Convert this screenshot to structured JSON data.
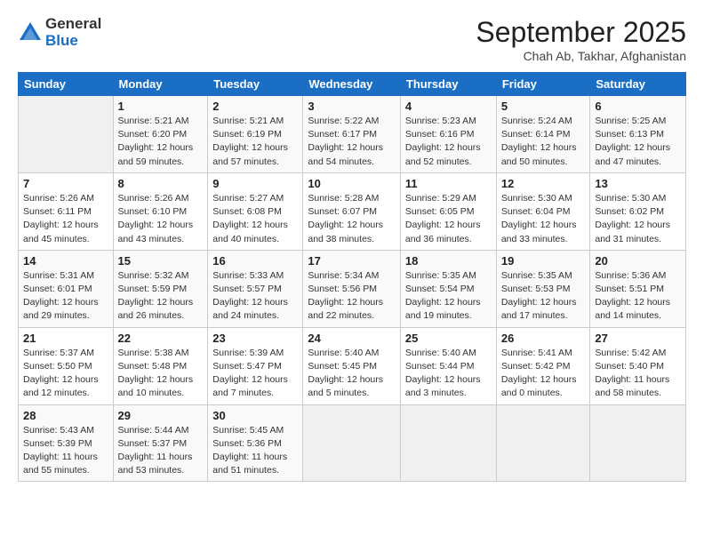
{
  "header": {
    "logo_general": "General",
    "logo_blue": "Blue",
    "month_title": "September 2025",
    "location": "Chah Ab, Takhar, Afghanistan"
  },
  "weekdays": [
    "Sunday",
    "Monday",
    "Tuesday",
    "Wednesday",
    "Thursday",
    "Friday",
    "Saturday"
  ],
  "weeks": [
    [
      {
        "day": "",
        "info": ""
      },
      {
        "day": "1",
        "info": "Sunrise: 5:21 AM\nSunset: 6:20 PM\nDaylight: 12 hours\nand 59 minutes."
      },
      {
        "day": "2",
        "info": "Sunrise: 5:21 AM\nSunset: 6:19 PM\nDaylight: 12 hours\nand 57 minutes."
      },
      {
        "day": "3",
        "info": "Sunrise: 5:22 AM\nSunset: 6:17 PM\nDaylight: 12 hours\nand 54 minutes."
      },
      {
        "day": "4",
        "info": "Sunrise: 5:23 AM\nSunset: 6:16 PM\nDaylight: 12 hours\nand 52 minutes."
      },
      {
        "day": "5",
        "info": "Sunrise: 5:24 AM\nSunset: 6:14 PM\nDaylight: 12 hours\nand 50 minutes."
      },
      {
        "day": "6",
        "info": "Sunrise: 5:25 AM\nSunset: 6:13 PM\nDaylight: 12 hours\nand 47 minutes."
      }
    ],
    [
      {
        "day": "7",
        "info": "Sunrise: 5:26 AM\nSunset: 6:11 PM\nDaylight: 12 hours\nand 45 minutes."
      },
      {
        "day": "8",
        "info": "Sunrise: 5:26 AM\nSunset: 6:10 PM\nDaylight: 12 hours\nand 43 minutes."
      },
      {
        "day": "9",
        "info": "Sunrise: 5:27 AM\nSunset: 6:08 PM\nDaylight: 12 hours\nand 40 minutes."
      },
      {
        "day": "10",
        "info": "Sunrise: 5:28 AM\nSunset: 6:07 PM\nDaylight: 12 hours\nand 38 minutes."
      },
      {
        "day": "11",
        "info": "Sunrise: 5:29 AM\nSunset: 6:05 PM\nDaylight: 12 hours\nand 36 minutes."
      },
      {
        "day": "12",
        "info": "Sunrise: 5:30 AM\nSunset: 6:04 PM\nDaylight: 12 hours\nand 33 minutes."
      },
      {
        "day": "13",
        "info": "Sunrise: 5:30 AM\nSunset: 6:02 PM\nDaylight: 12 hours\nand 31 minutes."
      }
    ],
    [
      {
        "day": "14",
        "info": "Sunrise: 5:31 AM\nSunset: 6:01 PM\nDaylight: 12 hours\nand 29 minutes."
      },
      {
        "day": "15",
        "info": "Sunrise: 5:32 AM\nSunset: 5:59 PM\nDaylight: 12 hours\nand 26 minutes."
      },
      {
        "day": "16",
        "info": "Sunrise: 5:33 AM\nSunset: 5:57 PM\nDaylight: 12 hours\nand 24 minutes."
      },
      {
        "day": "17",
        "info": "Sunrise: 5:34 AM\nSunset: 5:56 PM\nDaylight: 12 hours\nand 22 minutes."
      },
      {
        "day": "18",
        "info": "Sunrise: 5:35 AM\nSunset: 5:54 PM\nDaylight: 12 hours\nand 19 minutes."
      },
      {
        "day": "19",
        "info": "Sunrise: 5:35 AM\nSunset: 5:53 PM\nDaylight: 12 hours\nand 17 minutes."
      },
      {
        "day": "20",
        "info": "Sunrise: 5:36 AM\nSunset: 5:51 PM\nDaylight: 12 hours\nand 14 minutes."
      }
    ],
    [
      {
        "day": "21",
        "info": "Sunrise: 5:37 AM\nSunset: 5:50 PM\nDaylight: 12 hours\nand 12 minutes."
      },
      {
        "day": "22",
        "info": "Sunrise: 5:38 AM\nSunset: 5:48 PM\nDaylight: 12 hours\nand 10 minutes."
      },
      {
        "day": "23",
        "info": "Sunrise: 5:39 AM\nSunset: 5:47 PM\nDaylight: 12 hours\nand 7 minutes."
      },
      {
        "day": "24",
        "info": "Sunrise: 5:40 AM\nSunset: 5:45 PM\nDaylight: 12 hours\nand 5 minutes."
      },
      {
        "day": "25",
        "info": "Sunrise: 5:40 AM\nSunset: 5:44 PM\nDaylight: 12 hours\nand 3 minutes."
      },
      {
        "day": "26",
        "info": "Sunrise: 5:41 AM\nSunset: 5:42 PM\nDaylight: 12 hours\nand 0 minutes."
      },
      {
        "day": "27",
        "info": "Sunrise: 5:42 AM\nSunset: 5:40 PM\nDaylight: 11 hours\nand 58 minutes."
      }
    ],
    [
      {
        "day": "28",
        "info": "Sunrise: 5:43 AM\nSunset: 5:39 PM\nDaylight: 11 hours\nand 55 minutes."
      },
      {
        "day": "29",
        "info": "Sunrise: 5:44 AM\nSunset: 5:37 PM\nDaylight: 11 hours\nand 53 minutes."
      },
      {
        "day": "30",
        "info": "Sunrise: 5:45 AM\nSunset: 5:36 PM\nDaylight: 11 hours\nand 51 minutes."
      },
      {
        "day": "",
        "info": ""
      },
      {
        "day": "",
        "info": ""
      },
      {
        "day": "",
        "info": ""
      },
      {
        "day": "",
        "info": ""
      }
    ]
  ]
}
